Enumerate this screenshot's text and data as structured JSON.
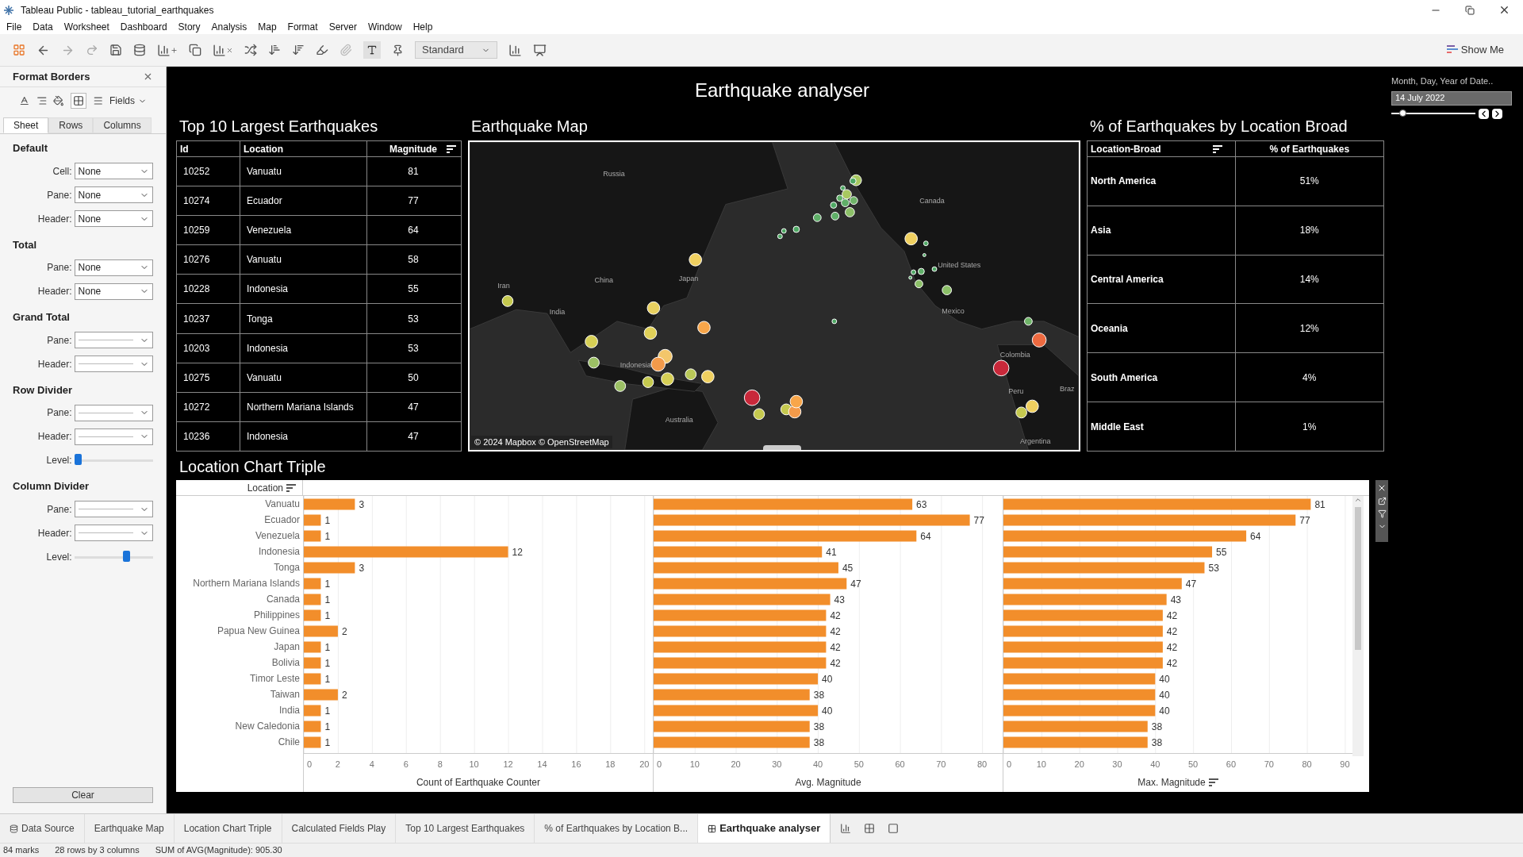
{
  "window": {
    "title": "Tableau Public - tableau_tutorial_earthquakes"
  },
  "menu": [
    "File",
    "Data",
    "Worksheet",
    "Dashboard",
    "Story",
    "Analysis",
    "Map",
    "Format",
    "Server",
    "Window",
    "Help"
  ],
  "toolbar": {
    "fit": "Standard",
    "show_me": "Show Me"
  },
  "format_panel": {
    "title": "Format Borders",
    "fields_button": "Fields",
    "tabs": [
      {
        "label": "Sheet",
        "selected": true
      },
      {
        "label": "Rows",
        "selected": false
      },
      {
        "label": "Columns",
        "selected": false
      }
    ],
    "sections": [
      {
        "heading": "Default",
        "rows": [
          {
            "kind": "select",
            "label": "Cell:",
            "value": "None"
          },
          {
            "kind": "select",
            "label": "Pane:",
            "value": "None"
          },
          {
            "kind": "select",
            "label": "Header:",
            "value": "None"
          }
        ]
      },
      {
        "heading": "Total",
        "rows": [
          {
            "kind": "select",
            "label": "Pane:",
            "value": "None"
          },
          {
            "kind": "select",
            "label": "Header:",
            "value": "None"
          }
        ]
      },
      {
        "heading": "Grand Total",
        "rows": [
          {
            "kind": "line-select",
            "label": "Pane:"
          },
          {
            "kind": "line-select",
            "label": "Header:"
          }
        ]
      },
      {
        "heading": "Row Divider",
        "rows": [
          {
            "kind": "line-select",
            "label": "Pane:"
          },
          {
            "kind": "line-select",
            "label": "Header:"
          },
          {
            "kind": "slider",
            "label": "Level:",
            "level": 0.0
          }
        ]
      },
      {
        "heading": "Column Divider",
        "rows": [
          {
            "kind": "line-select",
            "label": "Pane:"
          },
          {
            "kind": "line-select",
            "label": "Header:"
          },
          {
            "kind": "slider",
            "label": "Level:",
            "level": 0.67
          }
        ]
      }
    ],
    "clear": "Clear"
  },
  "dashboard": {
    "title": "Earthquake analyser",
    "top10": {
      "title": "Top 10 Largest Earthquakes",
      "columns": [
        "Id",
        "Location",
        "Magnitude"
      ],
      "rows": [
        [
          "10252",
          "Vanuatu",
          "81"
        ],
        [
          "10274",
          "Ecuador",
          "77"
        ],
        [
          "10259",
          "Venezuela",
          "64"
        ],
        [
          "10276",
          "Vanuatu",
          "58"
        ],
        [
          "10228",
          "Indonesia",
          "55"
        ],
        [
          "10237",
          "Tonga",
          "53"
        ],
        [
          "10203",
          "Indonesia",
          "53"
        ],
        [
          "10275",
          "Vanuatu",
          "50"
        ],
        [
          "10272",
          "Northern Mariana Islands",
          "47"
        ],
        [
          "10236",
          "Indonesia",
          "47"
        ]
      ]
    },
    "map": {
      "title": "Earthquake Map",
      "labels": [
        "Russia",
        "Canada",
        "China",
        "Japan",
        "Iran",
        "India",
        "United States",
        "Mexico",
        "Indonesia",
        "Colombia",
        "Australia",
        "Peru",
        "Braz",
        "Argentina"
      ],
      "attribution": "© 2024 Mapbox © OpenStreetMap"
    },
    "location_broad": {
      "title": "% of Earthquakes by Location Broad",
      "columns": [
        "Location-Broad",
        "% of Earthquakes"
      ],
      "rows": [
        [
          "North America",
          "51%"
        ],
        [
          "Asia",
          "18%"
        ],
        [
          "Central America",
          "14%"
        ],
        [
          "Oceania",
          "12%"
        ],
        [
          "South America",
          "4%"
        ],
        [
          "Middle East",
          "1%"
        ]
      ]
    },
    "filter": {
      "label": "Month, Day, Year of Date..",
      "value": "14 July 2022",
      "level": 0.1
    },
    "chart": {
      "title": "Location Chart Triple",
      "row_header": "Location",
      "charts": [
        {
          "chart_data": {
            "type": "bar",
            "orientation": "horizontal",
            "xlabel": "Count of Earthquake Counter",
            "categories": [
              "Vanuatu",
              "Ecuador",
              "Venezuela",
              "Indonesia",
              "Tonga",
              "Northern Mariana Islands",
              "Canada",
              "Philippines",
              "Papua New Guinea",
              "Japan",
              "Bolivia",
              "Timor Leste",
              "Taiwan",
              "India",
              "New Caledonia",
              "Chile"
            ],
            "values": [
              3,
              1,
              1,
              12,
              3,
              1,
              1,
              1,
              2,
              1,
              1,
              1,
              2,
              1,
              1,
              1
            ],
            "xlim": [
              0,
              20.5
            ],
            "xticks": [
              0,
              2,
              4,
              6,
              8,
              10,
              12,
              14,
              16,
              18,
              20
            ],
            "grid": true,
            "data_labels": true
          }
        },
        {
          "chart_data": {
            "type": "bar",
            "orientation": "horizontal",
            "xlabel": "Avg. Magnitude",
            "values": [
              63,
              77,
              64,
              41,
              45,
              47,
              43,
              42,
              42,
              42,
              42,
              40,
              38,
              40,
              38,
              38
            ],
            "xlim": [
              0,
              85
            ],
            "xticks": [
              0,
              10,
              20,
              30,
              40,
              50,
              60,
              70,
              80
            ],
            "grid": true,
            "data_labels": true
          }
        },
        {
          "chart_data": {
            "type": "bar",
            "orientation": "horizontal",
            "xlabel": "Max. Magnitude",
            "values": [
              81,
              77,
              64,
              55,
              53,
              47,
              43,
              42,
              42,
              42,
              42,
              40,
              40,
              40,
              38,
              38
            ],
            "xlim": [
              0,
              92
            ],
            "xticks": [
              0,
              10,
              20,
              30,
              40,
              50,
              60,
              70,
              80,
              90
            ],
            "grid": true,
            "data_labels": true
          }
        }
      ]
    }
  },
  "sheet_tabs": [
    {
      "label": "Data Source",
      "kind": "source",
      "selected": false
    },
    {
      "label": "Earthquake Map",
      "kind": "sheet",
      "selected": false
    },
    {
      "label": "Location Chart Triple",
      "kind": "sheet",
      "selected": false
    },
    {
      "label": "Calculated Fields Play",
      "kind": "sheet",
      "selected": false
    },
    {
      "label": "Top 10 Largest Earthquakes",
      "kind": "sheet",
      "selected": false
    },
    {
      "label": "% of Earthquakes by Location B...",
      "kind": "sheet",
      "selected": false
    },
    {
      "label": "Earthquake analyser",
      "kind": "dashboard",
      "selected": true
    }
  ],
  "status_bar": [
    "84 marks",
    "28 rows by 3 columns",
    "SUM of AVG(Magnitude): 905.30"
  ]
}
